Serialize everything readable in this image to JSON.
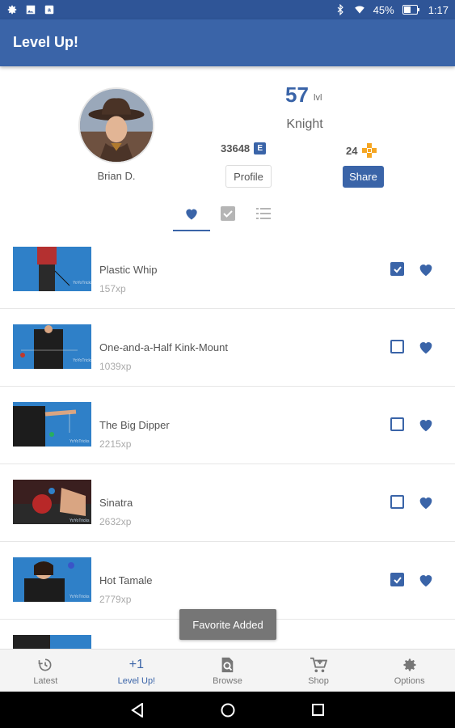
{
  "status_bar": {
    "battery": "45%",
    "time": "1:17",
    "icons": [
      "settings-icon",
      "image-icon",
      "amazon-icon",
      "bluetooth-icon",
      "wifi-icon",
      "battery-icon"
    ]
  },
  "app_bar": {
    "title": "Level Up!"
  },
  "profile": {
    "name": "Brian D.",
    "level": "57",
    "level_unit": "lvl",
    "rank": "Knight",
    "xp_total": "33648",
    "xp_badge": "E",
    "points": "24",
    "profile_button": "Profile",
    "share_button": "Share"
  },
  "tabs": [
    {
      "icon": "heart-icon",
      "active": true
    },
    {
      "icon": "checkbox-icon",
      "active": false
    },
    {
      "icon": "list-icon",
      "active": false
    }
  ],
  "items": [
    {
      "name": "Plastic Whip",
      "xp": "157xp",
      "checked": true,
      "favorite": true
    },
    {
      "name": "One-and-a-Half Kink-Mount",
      "xp": "1039xp",
      "checked": false,
      "favorite": true
    },
    {
      "name": "The Big Dipper",
      "xp": "2215xp",
      "checked": false,
      "favorite": true
    },
    {
      "name": "Sinatra",
      "xp": "2632xp",
      "checked": false,
      "favorite": true
    },
    {
      "name": "Hot Tamale",
      "xp": "2779xp",
      "checked": true,
      "favorite": true
    },
    {
      "name": "",
      "xp": "",
      "checked": false,
      "favorite": true
    }
  ],
  "toast": "Favorite Added",
  "bottom_nav": [
    {
      "label": "Latest",
      "icon": "refresh-clock-icon",
      "active": false
    },
    {
      "label": "Level Up!",
      "icon": "+1",
      "active": true
    },
    {
      "label": "Browse",
      "icon": "browse-icon",
      "active": false
    },
    {
      "label": "Shop",
      "icon": "cart-icon",
      "active": false
    },
    {
      "label": "Options",
      "icon": "gear-icon",
      "active": false
    }
  ],
  "colors": {
    "primary": "#3a64a8",
    "status_bar": "#2f5597",
    "accent_points": "#f5a623"
  }
}
